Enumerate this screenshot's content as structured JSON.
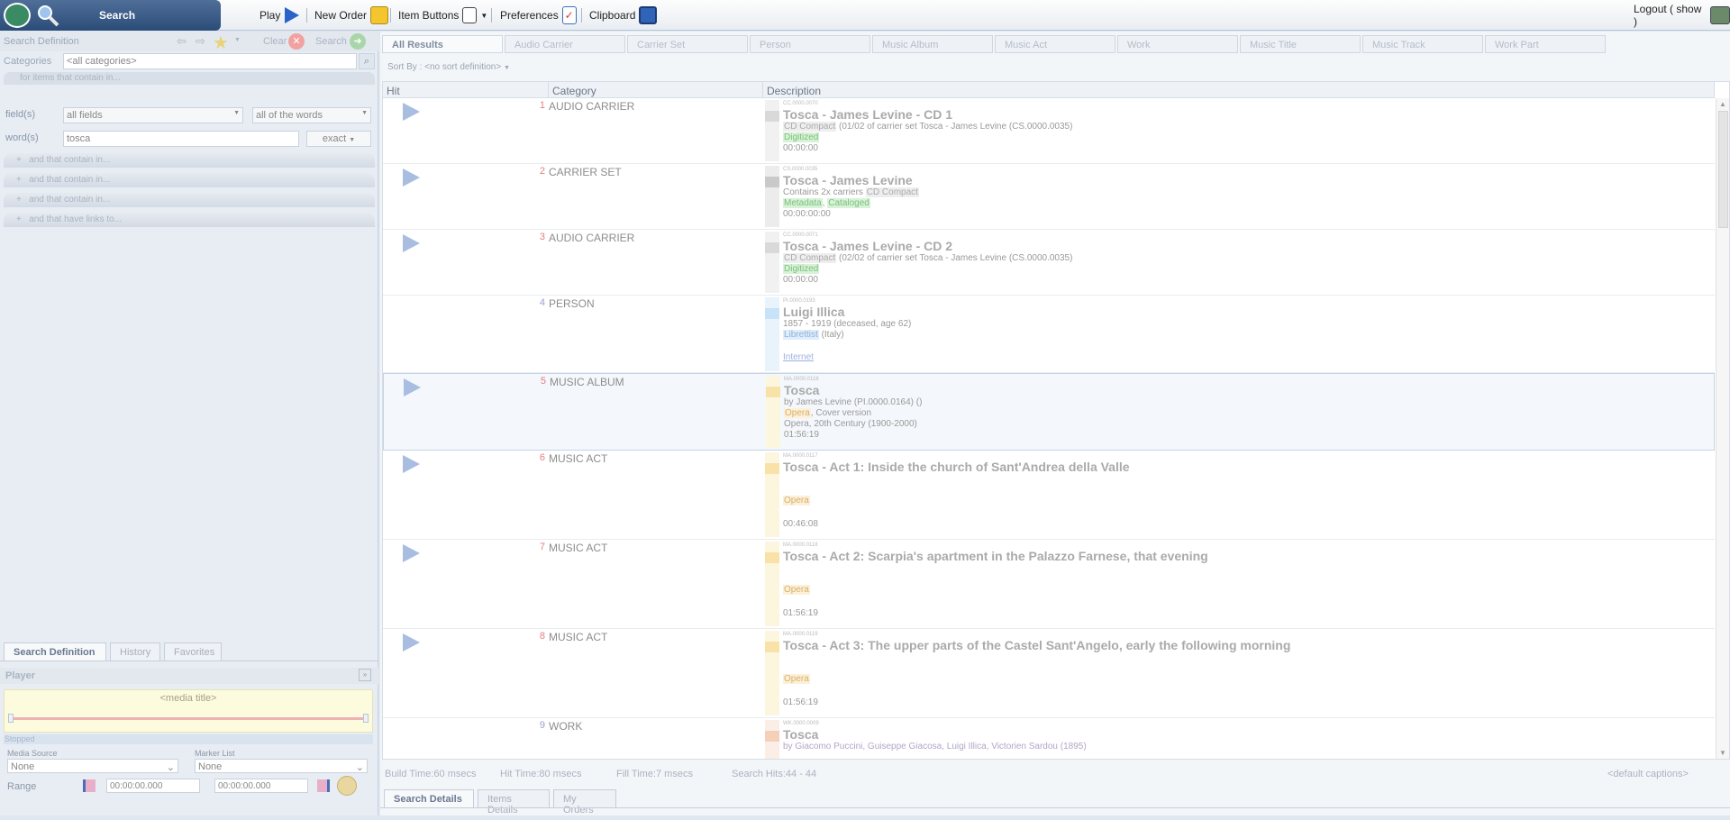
{
  "topbar": {
    "search_label": "Search",
    "play_label": "Play",
    "new_order_label": "New Order",
    "item_buttons_label": "Item Buttons",
    "preferences_label": "Preferences",
    "clipboard_label": "Clipboard",
    "logout_label": "Logout ( show )"
  },
  "left": {
    "search_definition_label": "Search Definition",
    "clear_label": "Clear",
    "search_label": "Search",
    "categories_label": "Categories",
    "categories_value": "<all categories>",
    "for_items_label": "for items that contain in...",
    "fields_label": "field(s)",
    "fields_value": "all fields",
    "words_mode_value": "all of the words",
    "words_label": "word(s)",
    "words_value": "tosca",
    "exact_value": "exact",
    "and_rows": [
      "and that contain in...",
      "and that contain in...",
      "and that contain in...",
      "and that have links to..."
    ],
    "tabs": [
      "Search Definition",
      "History",
      "Favorites"
    ],
    "player_label": "Player",
    "media_title": "<media title>",
    "stopped_label": "Stopped",
    "media_source_label": "Media Source",
    "media_source_value": "None",
    "marker_list_label": "Marker List",
    "marker_list_value": "None",
    "range_label": "Range",
    "range_start": "00:00:00.000",
    "range_end": "00:00:00.000"
  },
  "right": {
    "tabs": [
      "All Results",
      "Audio Carrier",
      "Carrier Set",
      "Person",
      "Music Album",
      "Music Act",
      "Work",
      "Music Title",
      "Music Track",
      "Work Part"
    ],
    "sort_label": "Sort By : <no sort definition>",
    "columns": [
      "Hit",
      "Category",
      "Description"
    ],
    "rows": [
      {
        "num": "1",
        "cat": "AUDIO CARRIER",
        "id": "CC.0000.0070",
        "title": "Tosca - James Levine - CD 1",
        "l1a": "CD Compact",
        "l1b": " (01/02 of carrier set Tosca - James Levine (CS.0000.0035)",
        "l2": "Digitized",
        "l3": "00:00:00"
      },
      {
        "num": "2",
        "cat": "CARRIER SET",
        "id": "CS.0000.0035",
        "title": "Tosca - James Levine",
        "l1a": "Contains 2x carriers ",
        "l1b": "CD Compact",
        "l2a": "Metadata",
        "l2b": "Cataloged",
        "l3": "00:00:00:00"
      },
      {
        "num": "3",
        "cat": "AUDIO CARRIER",
        "id": "CC.0000.0071",
        "title": "Tosca - James Levine - CD 2",
        "l1a": "CD Compact",
        "l1b": " (02/02 of carrier set Tosca - James Levine (CS.0000.0035)",
        "l2": "Digitized",
        "l3": "00:00:00"
      },
      {
        "num": "4",
        "cat": "PERSON",
        "id": "PI.0000.0193",
        "title": "Luigi Illica",
        "l1": "1857 - 1919 (deceased, age 62)",
        "l2a": "Librettist",
        "l2b": " (Italy)",
        "l3": "Internet"
      },
      {
        "num": "5",
        "cat": "MUSIC ALBUM",
        "id": "MA.0000.0118",
        "title": "Tosca",
        "l1": "by James Levine (PI.0000.0164) ()",
        "l2a": "Opera",
        "l2b": ", Cover version",
        "l3": "Opera, 20th Century (1900-2000)",
        "l4": "01:56:19"
      },
      {
        "num": "6",
        "cat": "MUSIC ACT",
        "id": "MA.0000.0117",
        "title": "Tosca - Act 1: Inside the church of Sant'Andrea della Valle",
        "l2": "Opera",
        "l3": "00:46:08"
      },
      {
        "num": "7",
        "cat": "MUSIC ACT",
        "id": "MA.0000.0118",
        "title": "Tosca - Act 2: Scarpia's apartment in the Palazzo Farnese, that evening",
        "l2": "Opera",
        "l3": "01:56:19"
      },
      {
        "num": "8",
        "cat": "MUSIC ACT",
        "id": "MA.0000.0119",
        "title": "Tosca - Act 3: The upper parts of the Castel Sant'Angelo, early the following morning",
        "l2": "Opera",
        "l3": "01:56:19"
      },
      {
        "num": "9",
        "cat": "WORK",
        "id": "WK.0000.0009",
        "title": "Tosca",
        "l1": "by Giacomo Puccini, Guiseppe Giacosa, Luigi Illica, Victorien Sardou (1895)"
      }
    ],
    "status": {
      "build": "Build Time:60 msecs",
      "hit": "Hit Time:80 msecs",
      "fill": "Fill Time:7 msecs",
      "hits": "Search Hits:44 - 44",
      "captions": "<default captions>"
    },
    "bottom_tabs": [
      "Search Details",
      "Items Details",
      "My Orders"
    ]
  },
  "colors": {
    "accent": "#2b4c78",
    "play": "#2a62c9"
  }
}
